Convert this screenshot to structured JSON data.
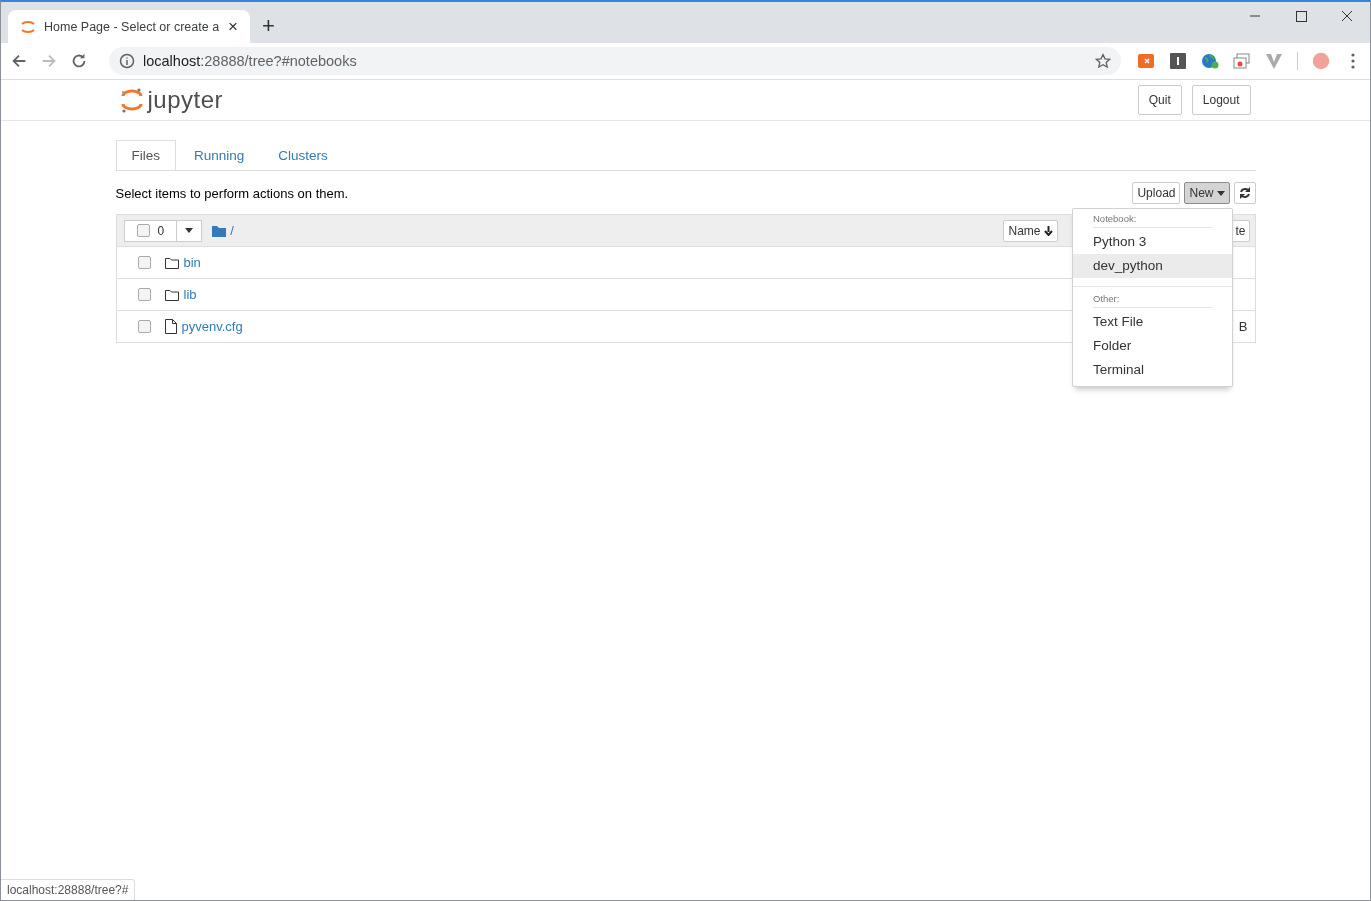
{
  "browser": {
    "tab": {
      "title": "Home Page - Select or create a",
      "close": "×"
    },
    "new_tab": "+",
    "address": {
      "host": "localhost",
      "rest": ":28888/tree?#notebooks"
    },
    "status_url": "localhost:28888/tree?#"
  },
  "header": {
    "logo_text": "jupyter",
    "buttons": [
      "Quit",
      "Logout"
    ]
  },
  "tabs": [
    {
      "label": "Files",
      "selected": true
    },
    {
      "label": "Running",
      "selected": false
    },
    {
      "label": "Clusters",
      "selected": false
    }
  ],
  "instruction": "Select items to perform actions on them.",
  "toolbar": [
    {
      "kind": "plain",
      "label": "Upload",
      "pressed": false
    },
    {
      "kind": "dropdown",
      "label": "New",
      "pressed": true
    },
    {
      "kind": "refresh"
    }
  ],
  "list": {
    "select_all_checked": false,
    "selected_count": "0",
    "path": "/",
    "sort_button": "Name",
    "column_3": "te",
    "rows": [
      {
        "kind": "folder",
        "name": "bin",
        "checked": false
      },
      {
        "kind": "folder",
        "name": "lib",
        "checked": false
      },
      {
        "kind": "file",
        "name": "pyvenv.cfg",
        "checked": false,
        "column_3": "B"
      }
    ]
  },
  "menu": {
    "sections": [
      {
        "heading": "Notebook:",
        "items": [
          {
            "label": "Python 3",
            "selected": false
          },
          {
            "label": "dev_python",
            "selected": true
          }
        ]
      },
      {
        "heading": "Other:",
        "items": [
          {
            "label": "Text File",
            "selected": false
          },
          {
            "label": "Folder",
            "selected": false
          },
          {
            "label": "Terminal",
            "selected": false
          }
        ]
      }
    ]
  }
}
